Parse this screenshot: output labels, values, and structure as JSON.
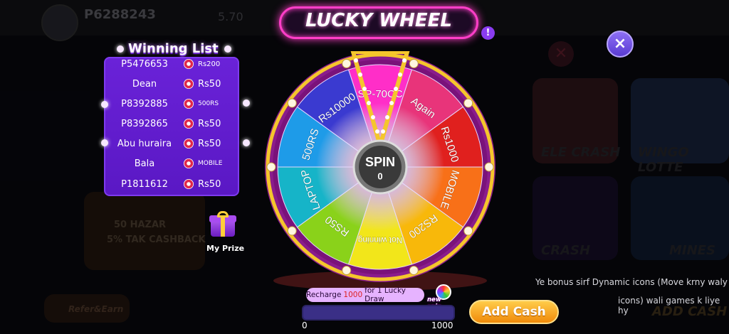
{
  "background": {
    "user_id": "P6288243",
    "balance": "5.70",
    "tiles": [
      "ELE CRASH",
      "WINGO LOTTE",
      "CRASH",
      "MINES",
      "Refer&Earn",
      "ADD CASH"
    ],
    "promo_lines": [
      "50 HAZAR",
      "5% TAK CASHBACK"
    ]
  },
  "dialog": {
    "title": "LUCKY WHEEL",
    "help_label": "!",
    "close_label": "×"
  },
  "winning_list": {
    "title": "Winning List",
    "entries": [
      {
        "name": "P5476653",
        "prize": "Rs200"
      },
      {
        "name": "Dean",
        "prize": "Rs50"
      },
      {
        "name": "P8392885",
        "prize": "500RS"
      },
      {
        "name": "P8392865",
        "prize": "Rs50"
      },
      {
        "name": "Abu huraira",
        "prize": "Rs50"
      },
      {
        "name": "Bala",
        "prize": "MOBILE"
      },
      {
        "name": "P1811612",
        "prize": "Rs50"
      }
    ]
  },
  "wheel": {
    "segments": [
      {
        "label": "SP-70CC",
        "color": "#ff2ec8"
      },
      {
        "label": "Again",
        "color": "#e8347a"
      },
      {
        "label": "Rs1000",
        "color": "#e0201e"
      },
      {
        "label": "MOBILE",
        "color": "#f87018"
      },
      {
        "label": "RS200",
        "color": "#f8b80a"
      },
      {
        "label": "Not winning",
        "color": "#f2e61a"
      },
      {
        "label": "RS50",
        "color": "#8ad21a"
      },
      {
        "label": "LAPTOP",
        "color": "#16b4c8"
      },
      {
        "label": "500RS",
        "color": "#1e9be8"
      },
      {
        "label": "Rs10000",
        "color": "#3a3ad0"
      }
    ],
    "spin_label": "SPIN",
    "spin_count": "0",
    "rim_color": "#f5c62c"
  },
  "recharge": {
    "prefix": "Recharge",
    "amount": "1000",
    "suffix": "for 1 Lucky Draw"
  },
  "new_spin_label": "new spin",
  "progress": {
    "min_label": "0",
    "max_label": "1000",
    "value_fraction": 0
  },
  "add_cash_label": "Add Cash",
  "my_prize_label": "My Prize",
  "hint_text": [
    "Ye bonus sirf Dynamic icons (Move krny waly",
    "icons) wali games k liye hy"
  ]
}
